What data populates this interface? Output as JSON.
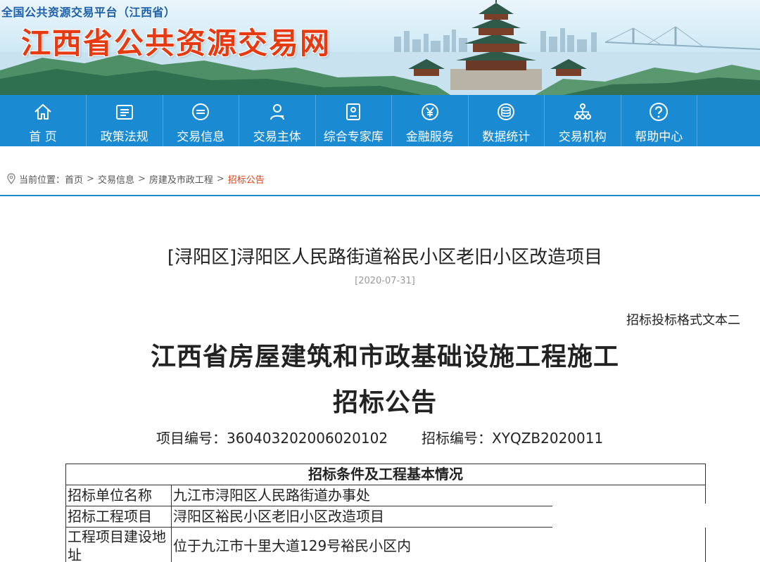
{
  "banner": {
    "platform_name": "全国公共资源交易平台（江西省）",
    "site_name": "江西省公共资源交易网"
  },
  "nav": {
    "items": [
      {
        "label": "首 页",
        "icon": "home-icon"
      },
      {
        "label": "政策法规",
        "icon": "document-list-icon"
      },
      {
        "label": "交易信息",
        "icon": "message-circle-icon"
      },
      {
        "label": "交易主体",
        "icon": "user-icon"
      },
      {
        "label": "综合专家库",
        "icon": "id-card-icon"
      },
      {
        "label": "金融服务",
        "icon": "yuan-icon"
      },
      {
        "label": "数据统计",
        "icon": "database-icon"
      },
      {
        "label": "交易机构",
        "icon": "org-chart-icon"
      },
      {
        "label": "帮助中心",
        "icon": "help-icon"
      }
    ],
    "color": "#1a8bd3"
  },
  "breadcrumb": {
    "prefix": "当前位置：",
    "items": [
      "首页",
      "交易信息",
      "房建及市政工程"
    ],
    "current": "招标公告",
    "separator": ">"
  },
  "article": {
    "title": "[浔阳区]浔阳区人民路街道裕民小区老旧小区改造项目",
    "date": "[2020-07-31]"
  },
  "document": {
    "format_label": "招标投标格式文本二",
    "title_line1": "江西省房屋建筑和市政基础设施工程施工",
    "title_line2": "招标公告",
    "project_no_label": "项目编号：",
    "project_no": "360403202006020102",
    "tender_no_label": "招标编号：",
    "tender_no": "XYQZB2020011"
  },
  "table": {
    "header": "招标条件及工程基本情况",
    "rows": [
      {
        "key": "招标单位名称",
        "value": "九江市浔阳区人民路街道办事处"
      },
      {
        "key": "招标工程项目",
        "value": "浔阳区裕民小区老旧小区改造项目"
      },
      {
        "key": "工程项目建设地址",
        "value": "位于九江市十里大道129号裕民小区内"
      }
    ]
  },
  "colors": {
    "accent": "#1a8bd3",
    "site_title": "#e63b12",
    "current_crumb": "#e63b12"
  }
}
